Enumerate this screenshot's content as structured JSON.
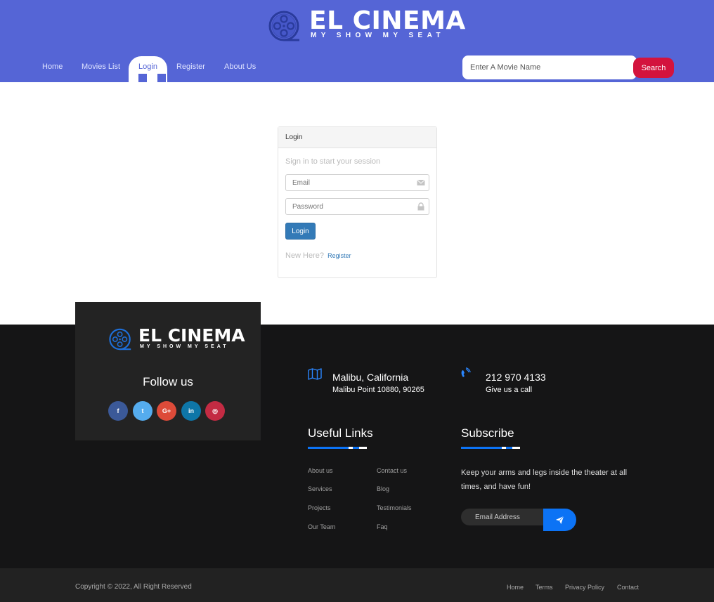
{
  "brand": {
    "name": "EL CINEMA",
    "tagline": "MY SHOW MY SEAT"
  },
  "nav": {
    "items": [
      {
        "label": "Home",
        "active": false
      },
      {
        "label": "Movies List",
        "active": false
      },
      {
        "label": "Login",
        "active": true
      },
      {
        "label": "Register",
        "active": false
      },
      {
        "label": "About Us",
        "active": false
      }
    ]
  },
  "search": {
    "placeholder": "Enter A Movie Name",
    "button_label": "Search"
  },
  "login": {
    "header": "Login",
    "subtitle": "Sign in to start your session",
    "email_placeholder": "Email",
    "password_placeholder": "Password",
    "button_label": "Login",
    "new_here": "New Here?",
    "register_link": "Register"
  },
  "footer": {
    "follow_title": "Follow us",
    "socials": [
      {
        "icon": "facebook-icon",
        "glyph": "f",
        "color": "#3b5998"
      },
      {
        "icon": "twitter-icon",
        "glyph": "t",
        "color": "#55acee"
      },
      {
        "icon": "google-plus-icon",
        "glyph": "G+",
        "color": "#dd4b39"
      },
      {
        "icon": "linkedin-icon",
        "glyph": "in",
        "color": "#0e76a8"
      },
      {
        "icon": "instagram-icon",
        "glyph": "◎",
        "color": "#c32b43"
      }
    ],
    "location": {
      "title": "Malibu, California",
      "subtitle": "Malibu Point 10880, 90265",
      "icon": "map-icon"
    },
    "phone": {
      "title": "212 970 4133",
      "subtitle": "Give us a call",
      "icon": "phone-icon"
    },
    "useful_links_title": "Useful Links",
    "useful_links": [
      "About us",
      "Contact us",
      "Services",
      "Blog",
      "Projects",
      "Testimonials",
      "Our Team",
      "Faq"
    ],
    "subscribe_title": "Subscribe",
    "subscribe_text": "Keep your arms and legs inside the theater at all times, and have fun!",
    "email_placeholder": "Email Address",
    "send_icon": "send-icon",
    "copyright": "Copyright © 2022, All Right Reserved",
    "bottom_links": [
      "Home",
      "Terms",
      "Privacy Policy",
      "Contact"
    ]
  },
  "colors": {
    "header_bg": "#5565d6",
    "search_button": "#d3133d",
    "login_button": "#337ab7",
    "footer_bg": "#151516",
    "accent_blue": "#0c73f5"
  }
}
